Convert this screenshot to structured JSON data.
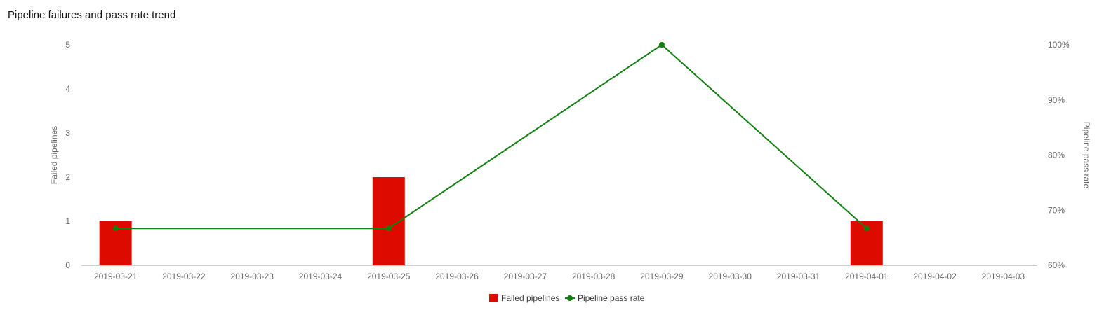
{
  "chart_data": {
    "type": "bar",
    "title": "Pipeline failures and pass rate trend",
    "xlabel": "",
    "ylabel": "Failed pipelines",
    "y2label": "Pipeline pass rate",
    "categories": [
      "2019-03-21",
      "2019-03-22",
      "2019-03-23",
      "2019-03-24",
      "2019-03-25",
      "2019-03-26",
      "2019-03-27",
      "2019-03-28",
      "2019-03-29",
      "2019-03-30",
      "2019-03-31",
      "2019-04-01",
      "2019-04-02",
      "2019-04-03"
    ],
    "ylim": [
      0,
      5
    ],
    "y_ticks": [
      0,
      1,
      2,
      3,
      4,
      5
    ],
    "y2lim": [
      60,
      100
    ],
    "y2_ticks": [
      "60%",
      "70%",
      "80%",
      "90%",
      "100%"
    ],
    "grid": false,
    "legend_position": "bottom",
    "series": [
      {
        "name": "Failed pipelines",
        "type": "bar",
        "axis": "left",
        "color": "#dd0a00",
        "values": [
          1,
          0,
          0,
          0,
          2,
          0,
          0,
          0,
          0,
          0,
          0,
          1,
          0,
          0
        ]
      },
      {
        "name": "Pipeline pass rate",
        "type": "line",
        "axis": "right",
        "color": "#108010",
        "points": [
          {
            "x": "2019-03-21",
            "y": 66.7
          },
          {
            "x": "2019-03-25",
            "y": 66.7
          },
          {
            "x": "2019-03-29",
            "y": 100
          },
          {
            "x": "2019-04-01",
            "y": 66.7
          }
        ]
      }
    ]
  }
}
